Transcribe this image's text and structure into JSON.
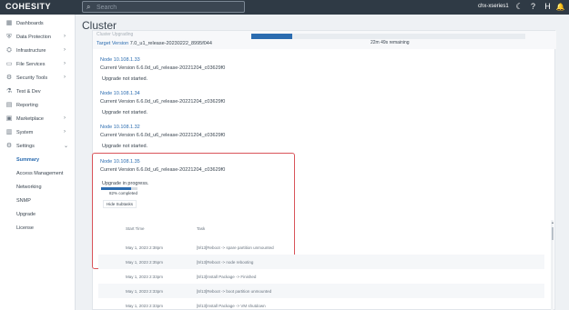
{
  "topbar": {
    "logo": "COHESITY",
    "search_placeholder": "Search",
    "cluster_name": "chx-xseries1",
    "icons": [
      "moon-icon",
      "help-icon",
      "h-icon",
      "bell-icon"
    ],
    "icon_glyphs": [
      "☾",
      "?",
      "H",
      "🔔"
    ]
  },
  "sidebar": {
    "items": [
      {
        "label": "Dashboards",
        "icon": "dashboard-icon",
        "glyph": "▦",
        "chevron": ""
      },
      {
        "label": "Data Protection",
        "icon": "shield-icon",
        "glyph": "⛨",
        "chevron": "›"
      },
      {
        "label": "Infrastructure",
        "icon": "infrastructure-icon",
        "glyph": "⛭",
        "chevron": "›"
      },
      {
        "label": "File Services",
        "icon": "folder-icon",
        "glyph": "▭",
        "chevron": "›"
      },
      {
        "label": "Security Tools",
        "icon": "security-icon",
        "glyph": "⚙",
        "chevron": "›"
      },
      {
        "label": "Test & Dev",
        "icon": "test-dev-icon",
        "glyph": "⚗",
        "chevron": ""
      },
      {
        "label": "Reporting",
        "icon": "report-icon",
        "glyph": "▤",
        "chevron": ""
      },
      {
        "label": "Marketplace",
        "icon": "marketplace-icon",
        "glyph": "▣",
        "chevron": "›"
      },
      {
        "label": "System",
        "icon": "system-icon",
        "glyph": "▥",
        "chevron": "›"
      },
      {
        "label": "Settings",
        "icon": "settings-icon",
        "glyph": "⚙",
        "chevron": "⌄"
      }
    ],
    "sub_items": [
      {
        "label": "Summary",
        "active": true
      },
      {
        "label": "Access Management",
        "active": false
      },
      {
        "label": "Networking",
        "active": false
      },
      {
        "label": "SNMP",
        "active": false
      },
      {
        "label": "Upgrade",
        "active": false
      },
      {
        "label": "License",
        "active": false
      }
    ]
  },
  "main": {
    "title": "Cluster",
    "prev_text": "Cluster Upgrading",
    "target_label": "Target Version",
    "target_value": "7.0_u1_release-20230222_8995f044",
    "time_remaining": "22m 49s remaining",
    "overall_progress": 0.15,
    "nodes": [
      {
        "name": "Node 10.108.1.33",
        "version": "Current Version 6.6.0d_u6_release-20221204_c03629f0",
        "status": "Upgrade not started."
      },
      {
        "name": "Node 10.108.1.34",
        "version": "Current Version 6.6.0d_u6_release-20221204_c03629f0",
        "status": "Upgrade not started."
      },
      {
        "name": "Node 10.108.1.32",
        "version": "Current Version 6.6.0d_u6_release-20221204_c03629f0",
        "status": "Upgrade not started."
      },
      {
        "name": "Node 10.108.1.35",
        "version": "Current Version 6.6.0d_u6_release-20221204_c03629f0",
        "status": "Upgrade in progress."
      }
    ],
    "node_progress": 0.82,
    "progress_text": "82% completed",
    "hide_subtasks": "Hide Subtasks",
    "table": {
      "col_time": "Start Time",
      "col_task": "Task",
      "rows": [
        {
          "time": "May 1, 2023 2:38pm",
          "task": "[9/13]Reboot -> spare partition unmounted"
        },
        {
          "time": "May 1, 2023 2:35pm",
          "task": "[9/13]Reboot -> node rebooting"
        },
        {
          "time": "May 1, 2023 2:33pm",
          "task": "[8/13]Install Package -> Finished"
        },
        {
          "time": "May 1, 2023 2:33pm",
          "task": "[8/13]Reboot -> boot partition unmounted"
        },
        {
          "time": "May 1, 2023 2:33pm",
          "task": "[8/13]Install Package -> VM shutdown"
        }
      ]
    }
  }
}
